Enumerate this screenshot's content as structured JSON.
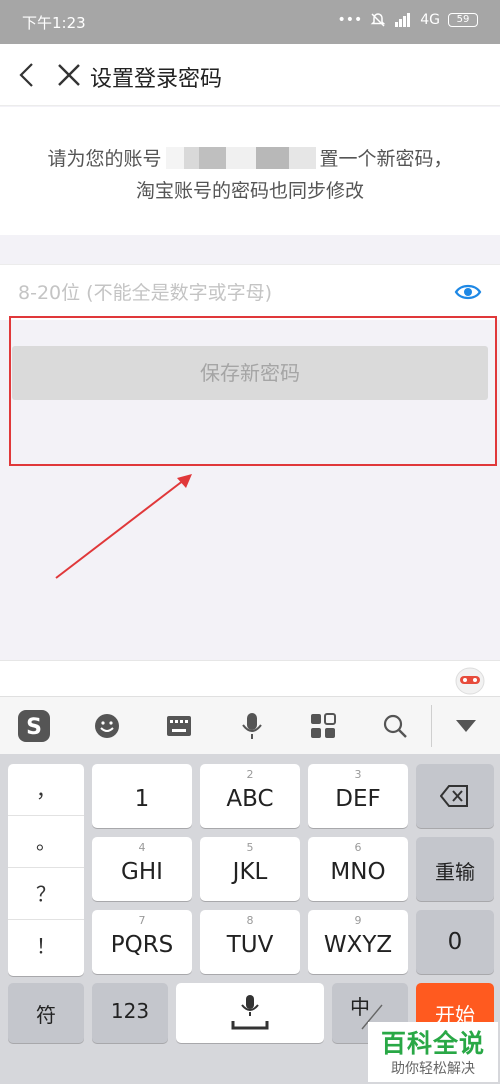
{
  "status_bar": {
    "time": "下午1:23",
    "network": "4G",
    "battery": "59"
  },
  "header": {
    "title": "设置登录密码"
  },
  "info": {
    "line1_before": "请为您的账号",
    "line1_after": "置一个新密码，",
    "line2": "淘宝账号的密码也同步修改"
  },
  "password": {
    "placeholder": "8-20位 (不能全是数字或字母)",
    "value": ""
  },
  "save_button": {
    "label": "保存新密码"
  },
  "keyboard": {
    "punctuation": [
      "，",
      "。",
      "？",
      "！"
    ],
    "keys": [
      {
        "main": "1",
        "sub": ""
      },
      {
        "main": "ABC",
        "sub": "2"
      },
      {
        "main": "DEF",
        "sub": "3"
      },
      {
        "main": "GHI",
        "sub": "4"
      },
      {
        "main": "JKL",
        "sub": "5"
      },
      {
        "main": "MNO",
        "sub": "6"
      },
      {
        "main": "PQRS",
        "sub": "7"
      },
      {
        "main": "TUV",
        "sub": "8"
      },
      {
        "main": "WXYZ",
        "sub": "9"
      }
    ],
    "reenter": "重输",
    "zero": "0",
    "symbol": "符",
    "numbers": "123",
    "lang_zh": "中",
    "start": "开始"
  },
  "watermark": {
    "title": "百科全说",
    "subtitle": "助你轻松解决"
  },
  "colors": {
    "highlight": "#e0383a",
    "accent_orange": "#ff5a1f",
    "eye_blue": "#1e88e5",
    "watermark_green": "#29a846"
  }
}
